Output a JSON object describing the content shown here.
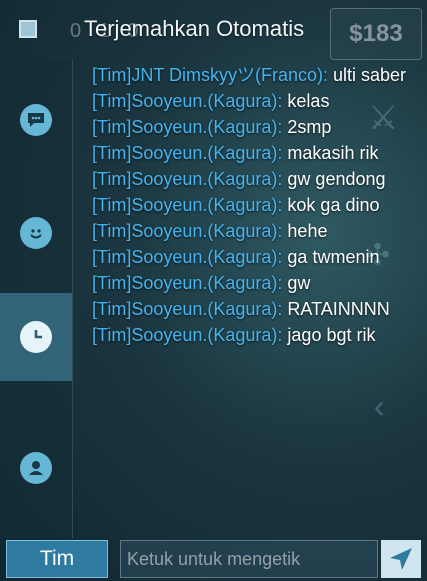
{
  "header": {
    "title": "Terjemahkan Otomatis",
    "checkbox_checked": true
  },
  "hud": {
    "gold": "$183",
    "kda": "0  1  0"
  },
  "sidebar": {
    "items": [
      {
        "icon": "chat-bubble-icon",
        "active": false
      },
      {
        "icon": "emoji-icon",
        "active": false
      },
      {
        "icon": "clock-icon",
        "active": true
      },
      {
        "icon": "voice-icon",
        "active": false
      }
    ]
  },
  "messages": [
    {
      "sender": "[Tim]JNT  Dimskyyツ(Franco):",
      "text": " ulti saber"
    },
    {
      "sender": "[Tim]Sooyeun.(Kagura):",
      "text": " kelas"
    },
    {
      "sender": "[Tim]Sooyeun.(Kagura):",
      "text": " 2smp"
    },
    {
      "sender": "[Tim]Sooyeun.(Kagura):",
      "text": " makasih rik"
    },
    {
      "sender": "[Tim]Sooyeun.(Kagura):",
      "text": " gw gendong"
    },
    {
      "sender": "[Tim]Sooyeun.(Kagura):",
      "text": " kok ga dino"
    },
    {
      "sender": "[Tim]Sooyeun.(Kagura):",
      "text": " hehe"
    },
    {
      "sender": "[Tim]Sooyeun.(Kagura):",
      "text": " ga twmenin"
    },
    {
      "sender": "[Tim]Sooyeun.(Kagura):",
      "text": " gw"
    },
    {
      "sender": "[Tim]Sooyeun.(Kagura):",
      "text": " RATAINNNN"
    },
    {
      "sender": "[Tim]Sooyeun.(Kagura):",
      "text": " jago bgt rik"
    }
  ],
  "footer": {
    "channel_label": "Tim",
    "input_placeholder": "Ketuk untuk mengetik",
    "send_icon": "send-icon"
  },
  "colors": {
    "sender": "#45b4f0",
    "accent": "#2f7aa0"
  }
}
